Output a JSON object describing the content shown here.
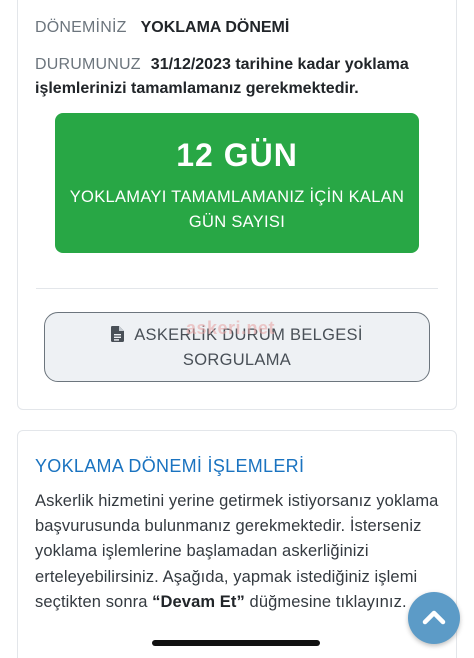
{
  "status": {
    "period_label": "DÖNEMİNİZ",
    "period_value": "YOKLAMA DÖNEMİ",
    "state_label": "DURUMUNUZ",
    "state_value": "31/12/2023 tarihine kadar yoklama işlemlerinizi tamamlamanız gerekmektedir."
  },
  "countdown": {
    "days": "12 GÜN",
    "description": "YOKLAMAYI TAMAMLAMANIZ İÇİN KALAN GÜN SAYISI",
    "color": "#28a745"
  },
  "query_button": {
    "icon": "document-icon",
    "line1": "ASKERLİK DURUM BELGESİ",
    "line2": "SORGULAMA"
  },
  "watermark": "askeri.net",
  "operations": {
    "title": "YOKLAMA DÖNEMİ İŞLEMLERİ",
    "text_before": "Askerlik hizmetini yerine getirmek istiyorsanız yoklama başvurusunda bulunmanız gerekmektedir. İsterseniz yoklama işlemlerine başlamadan askerliğinizi erteleyebilirsiniz. Aşağıda, yapmak istediğiniz işlemi seçtikten sonra ",
    "text_bold": "“Devam Et”",
    "text_after": " düğmesine tıklayınız.",
    "title_color": "#1a73c0"
  },
  "scroll_top": {
    "icon": "chevron-up-icon",
    "color": "#5c9bc7"
  }
}
